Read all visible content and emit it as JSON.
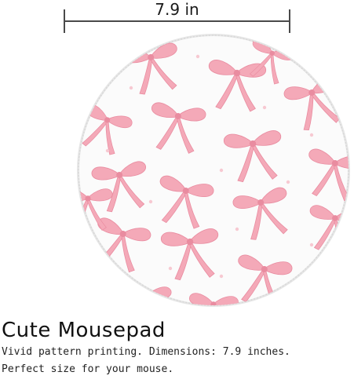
{
  "dimension": {
    "label": "7.9 in"
  },
  "product": {
    "name": "mousepad",
    "shape": "round",
    "pattern_icon": "pink-bow-icon",
    "colors": {
      "background": "#fbfbfb",
      "bow": "#f4a9b8",
      "bow_dark": "#e98ca0",
      "dot": "#f7c9d2",
      "stitch": "#e6e6e6"
    }
  },
  "caption": {
    "title": "Cute Mousepad",
    "line1": "Vivid pattern printing. Dimensions: 7.9 inches.",
    "line2": "Perfect size for your mouse."
  }
}
